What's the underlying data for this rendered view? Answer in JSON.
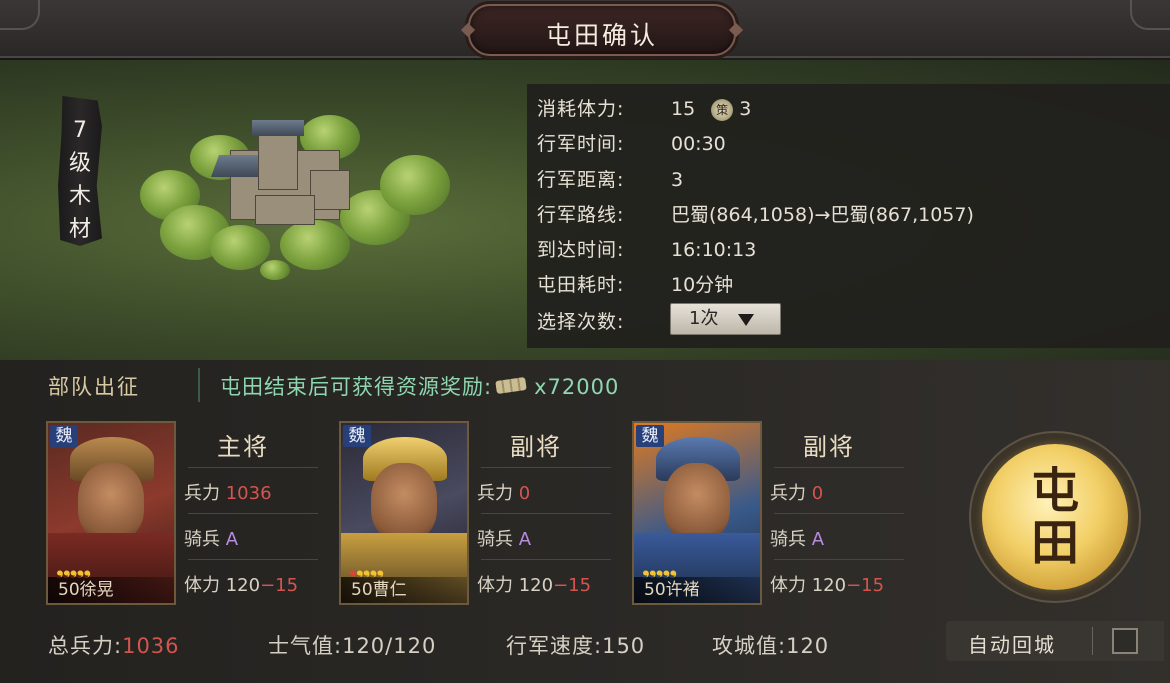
{
  "title": "屯田确认",
  "tile": {
    "level_text": [
      "7",
      "级",
      "木",
      "材"
    ]
  },
  "info": {
    "rows": [
      {
        "label": "消耗体力:",
        "value": "15",
        "extra_icon": "策",
        "extra_value": "3"
      },
      {
        "label": "行军时间:",
        "value": "00:30"
      },
      {
        "label": "行军距离:",
        "value": "3"
      },
      {
        "label": "行军路线:",
        "value": "巴蜀(864,1058)→巴蜀(867,1057)"
      },
      {
        "label": "到达时间:",
        "value": "16:10:13"
      },
      {
        "label": "屯田耗时:",
        "value": "10分钟"
      },
      {
        "label": "选择次数:",
        "value": ""
      }
    ],
    "select_value": "1次"
  },
  "troops": {
    "section_label": "部队出征",
    "reward_text": "屯田结束后可获得资源奖励:",
    "reward_value": "x72000",
    "generals": [
      {
        "faction": "魏",
        "role": "主将",
        "troops_label": "兵力",
        "troops": "1036",
        "type_label": "骑兵",
        "grade": "A",
        "stamina_label": "体力",
        "stamina": "120",
        "stamina_cost": "−15",
        "level_name": "50徐晃",
        "stars_red": 0
      },
      {
        "faction": "魏",
        "role": "副将",
        "troops_label": "兵力",
        "troops": "0",
        "type_label": "骑兵",
        "grade": "A",
        "stamina_label": "体力",
        "stamina": "120",
        "stamina_cost": "−15",
        "level_name": "50曹仁",
        "stars_red": 1
      },
      {
        "faction": "魏",
        "role": "副将",
        "troops_label": "兵力",
        "troops": "0",
        "type_label": "骑兵",
        "grade": "A",
        "stamina_label": "体力",
        "stamina": "120",
        "stamina_cost": "−15",
        "level_name": "50许褚",
        "stars_red": 0
      }
    ]
  },
  "action_button": {
    "line1": "屯",
    "line2": "田"
  },
  "footer": {
    "total_label": "总兵力:",
    "total_value": "1036",
    "morale_label": "士气值:",
    "morale_value": "120/120",
    "speed_label": "行军速度:",
    "speed_value": "150",
    "siege_label": "攻城值:",
    "siege_value": "120",
    "auto_return_label": "自动回城",
    "auto_return_checked": false
  },
  "colors": {
    "reward_text": "#8fd7b0",
    "red_value": "#d4544f",
    "grade": "#b88de0",
    "star": "#f2c230",
    "button_gold": "#f2cf66"
  }
}
